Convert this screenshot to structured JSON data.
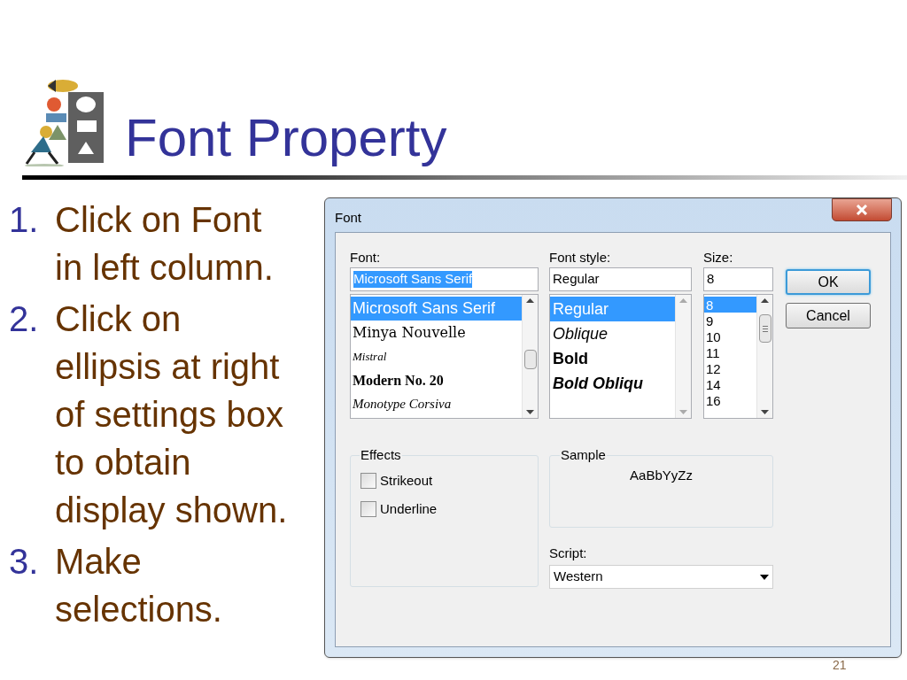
{
  "slide": {
    "title": "Font Property",
    "steps": [
      {
        "number": "1.",
        "lines": [
          "Click on Font",
          "in left column."
        ]
      },
      {
        "number": "2.",
        "lines": [
          "Click on",
          "ellipsis at right",
          "of settings box",
          "to obtain",
          "display shown."
        ]
      },
      {
        "number": "3.",
        "lines": [
          "Make",
          "selections."
        ]
      }
    ],
    "page_number": "21"
  },
  "dialog": {
    "title": "Font",
    "font": {
      "label": "Font:",
      "value": "Microsoft Sans Serif",
      "value_selected": true,
      "items": [
        {
          "label": "Microsoft Sans Serif",
          "kind": "sans",
          "selected": true
        },
        {
          "label": "Minya Nouvelle",
          "kind": "serif",
          "selected": false
        },
        {
          "label": "Mistral",
          "kind": "script",
          "selected": false
        },
        {
          "label": "Modern No. 20",
          "kind": "serif-bold",
          "selected": false
        },
        {
          "label": "Monotype Corsiva",
          "kind": "serif-italic",
          "selected": false
        }
      ]
    },
    "font_style": {
      "label": "Font style:",
      "value": "Regular",
      "value_selected": false,
      "items": [
        {
          "label": "Regular",
          "kind": "regular",
          "selected": true
        },
        {
          "label": "Oblique",
          "kind": "italic",
          "selected": false
        },
        {
          "label": "Bold",
          "kind": "bold",
          "selected": false
        },
        {
          "label": "Bold Obliqu",
          "kind": "bold-italic",
          "selected": false
        }
      ]
    },
    "size": {
      "label": "Size:",
      "value": "8",
      "value_selected": false,
      "items": [
        {
          "label": "8",
          "selected": true
        },
        {
          "label": "9",
          "selected": false
        },
        {
          "label": "10",
          "selected": false
        },
        {
          "label": "11",
          "selected": false
        },
        {
          "label": "12",
          "selected": false
        },
        {
          "label": "14",
          "selected": false
        },
        {
          "label": "16",
          "selected": false
        }
      ]
    },
    "buttons": [
      {
        "label": "OK",
        "default": true
      },
      {
        "label": "Cancel",
        "default": false
      }
    ],
    "effects": {
      "title": "Effects",
      "options": [
        {
          "label": "Strikeout",
          "checked": false
        },
        {
          "label": "Underline",
          "checked": false
        }
      ]
    },
    "sample": {
      "title": "Sample",
      "text": "AaBbYyZz"
    },
    "script": {
      "label": "Script:",
      "value": "Western"
    }
  }
}
